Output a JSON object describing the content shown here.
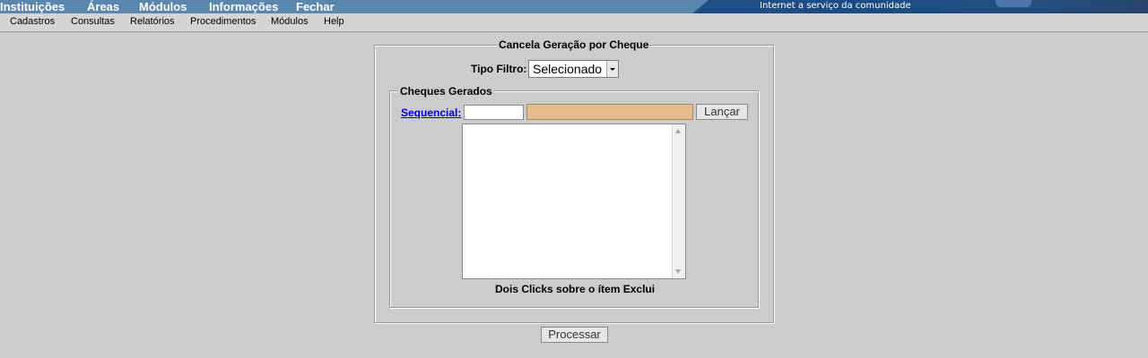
{
  "top_menu": {
    "items": [
      "Instituições",
      "Áreas",
      "Módulos",
      "Informações",
      "Fechar"
    ]
  },
  "brand": {
    "tagline": "Internet a serviço da comunidade"
  },
  "menu_bar": {
    "items": [
      "Cadastros",
      "Consultas",
      "Relatórios",
      "Procedimentos",
      "Módulos",
      "Help"
    ]
  },
  "form": {
    "title": "Cancela Geração por Cheque",
    "filter_label": "Tipo Filtro:",
    "filter_value": "Selecionado",
    "group_title": "Cheques Gerados",
    "sequencial_link": "Sequencial:",
    "sequencial_value": "",
    "description_value": "",
    "launch_button": "Lançar",
    "list_hint": "Dois Clicks sobre o ítem Exclui",
    "list_items": [],
    "process_button": "Processar"
  },
  "colors": {
    "topbar": "#5b86ad",
    "background": "#cccccc",
    "description_field": "#e5bd8b",
    "link": "#0000cc"
  }
}
